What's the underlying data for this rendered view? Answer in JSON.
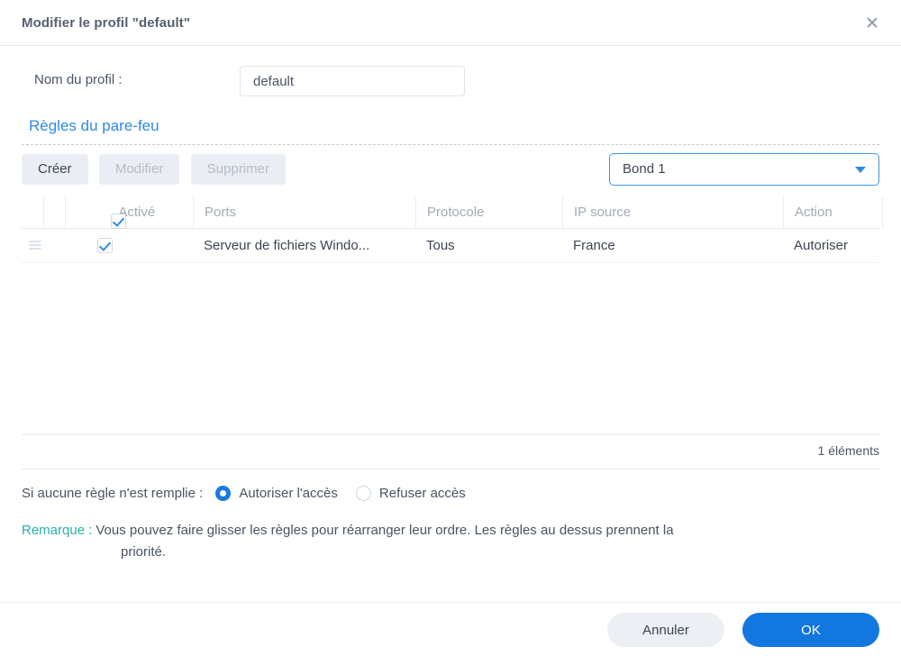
{
  "dialog": {
    "title": "Modifier le profil \"default\"",
    "close_icon": "close-icon"
  },
  "profile": {
    "label": "Nom du profil :",
    "value": "default",
    "placeholder": ""
  },
  "section": {
    "title": "Règles du pare-feu"
  },
  "toolbar": {
    "create_label": "Créer",
    "edit_label": "Modifier",
    "delete_label": "Supprimer"
  },
  "interface_select": {
    "value": "Bond 1",
    "caret_icon": "chevron-down-icon"
  },
  "table": {
    "headers": [
      {
        "label": "",
        "has_checkbox": false
      },
      {
        "label": "Activé",
        "has_checkbox": true
      },
      {
        "label": "Ports",
        "has_checkbox": false
      },
      {
        "label": "Protocole",
        "has_checkbox": false
      },
      {
        "label": "IP source",
        "has_checkbox": false
      },
      {
        "label": "Action",
        "has_checkbox": false
      },
      {
        "label": "",
        "has_checkbox": false
      }
    ],
    "rows": [
      {
        "enabled": true,
        "ports": "Serveur de fichiers Windo...",
        "protocol": "Tous",
        "source_ip": "France",
        "action": "Autoriser"
      }
    ],
    "count_text": "1 éléments"
  },
  "policy": {
    "label": "Si aucune règle n'est remplie :",
    "options": [
      {
        "label": "Autoriser l'accès",
        "selected": true
      },
      {
        "label": "Refuser accès",
        "selected": false
      }
    ]
  },
  "remark": {
    "key": "Remarque :",
    "line1": "Vous pouvez faire glisser les règles pour réarranger leur ordre. Les règles au dessus prennent la",
    "line2": "priorité."
  },
  "footer": {
    "cancel_label": "Annuler",
    "ok_label": "OK"
  },
  "colors": {
    "accent": "#1278e0",
    "link": "#2e8ae6",
    "remark": "#27b0ab",
    "text": "#4a5464",
    "muted": "#a2aab6"
  }
}
